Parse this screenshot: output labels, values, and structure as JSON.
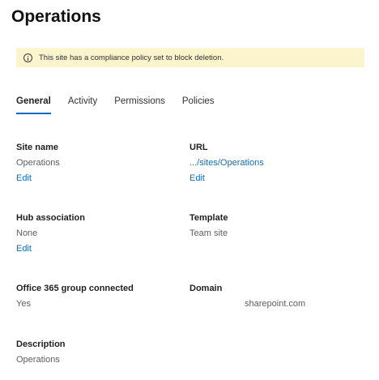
{
  "page": {
    "title": "Operations"
  },
  "banner": {
    "icon": "info-icon",
    "text": "This site has a compliance policy set to block deletion.",
    "background": "#fcf4cd"
  },
  "tabs": [
    {
      "label": "General",
      "active": true
    },
    {
      "label": "Activity",
      "active": false
    },
    {
      "label": "Permissions",
      "active": false
    },
    {
      "label": "Policies",
      "active": false
    }
  ],
  "fields": {
    "site_name": {
      "label": "Site name",
      "value": "Operations",
      "edit": "Edit"
    },
    "url": {
      "label": "URL",
      "value": ".../sites/Operations",
      "edit": "Edit"
    },
    "hub_association": {
      "label": "Hub association",
      "value": "None",
      "edit": "Edit"
    },
    "template": {
      "label": "Template",
      "value": "Team site"
    },
    "group": {
      "label": "Office 365 group connected",
      "value": "Yes"
    },
    "domain": {
      "label": "Domain",
      "value": "sharepoint.com"
    },
    "description": {
      "label": "Description",
      "value": "Operations"
    }
  },
  "colors": {
    "accent": "#0f6cbd",
    "muted_text": "#605e5c"
  }
}
